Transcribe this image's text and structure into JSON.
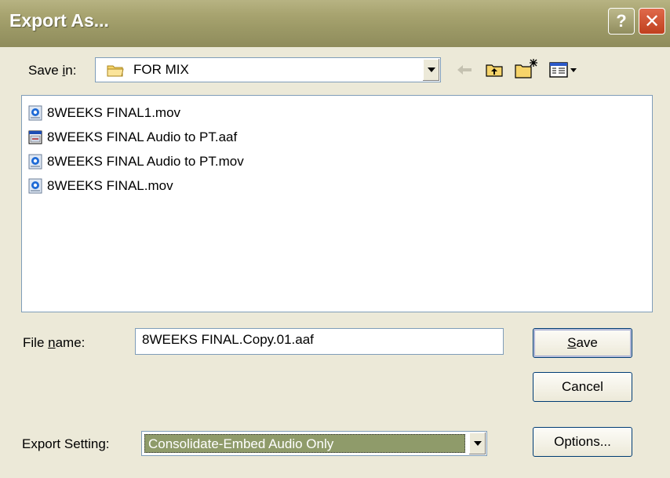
{
  "window": {
    "title": "Export As...",
    "help_label": "?",
    "close_label": "✕"
  },
  "save_in": {
    "label_prefix": "Save ",
    "label_underlined": "i",
    "label_suffix": "n:",
    "value": "FOR MIX"
  },
  "toolbar": {
    "back_icon": "back-arrow-icon",
    "up_icon": "up-folder-icon",
    "new_folder_icon": "new-folder-icon",
    "view_menu_icon": "view-menu-icon"
  },
  "files": [
    {
      "name": "8WEEKS FINAL1.mov",
      "icon": "quicktime-file-icon"
    },
    {
      "name": "8WEEKS FINAL Audio to PT.aaf",
      "icon": "aaf-file-icon"
    },
    {
      "name": "8WEEKS FINAL Audio to PT.mov",
      "icon": "quicktime-file-icon"
    },
    {
      "name": "8WEEKS FINAL.mov",
      "icon": "quicktime-file-icon"
    }
  ],
  "file_name": {
    "label_prefix": "File ",
    "label_underlined": "n",
    "label_suffix": "ame:",
    "value": "8WEEKS FINAL.Copy.01.aaf"
  },
  "export_setting": {
    "label": "Export Setting:",
    "value": "Consolidate-Embed Audio Only"
  },
  "buttons": {
    "save_underlined": "S",
    "save_rest": "ave",
    "cancel": "Cancel",
    "options": "Options..."
  },
  "colors": {
    "title_bar": "#9c9966",
    "dialog_bg": "#ece9d8",
    "selected_bg": "#8f9b6a",
    "close_button": "#d0502e"
  }
}
